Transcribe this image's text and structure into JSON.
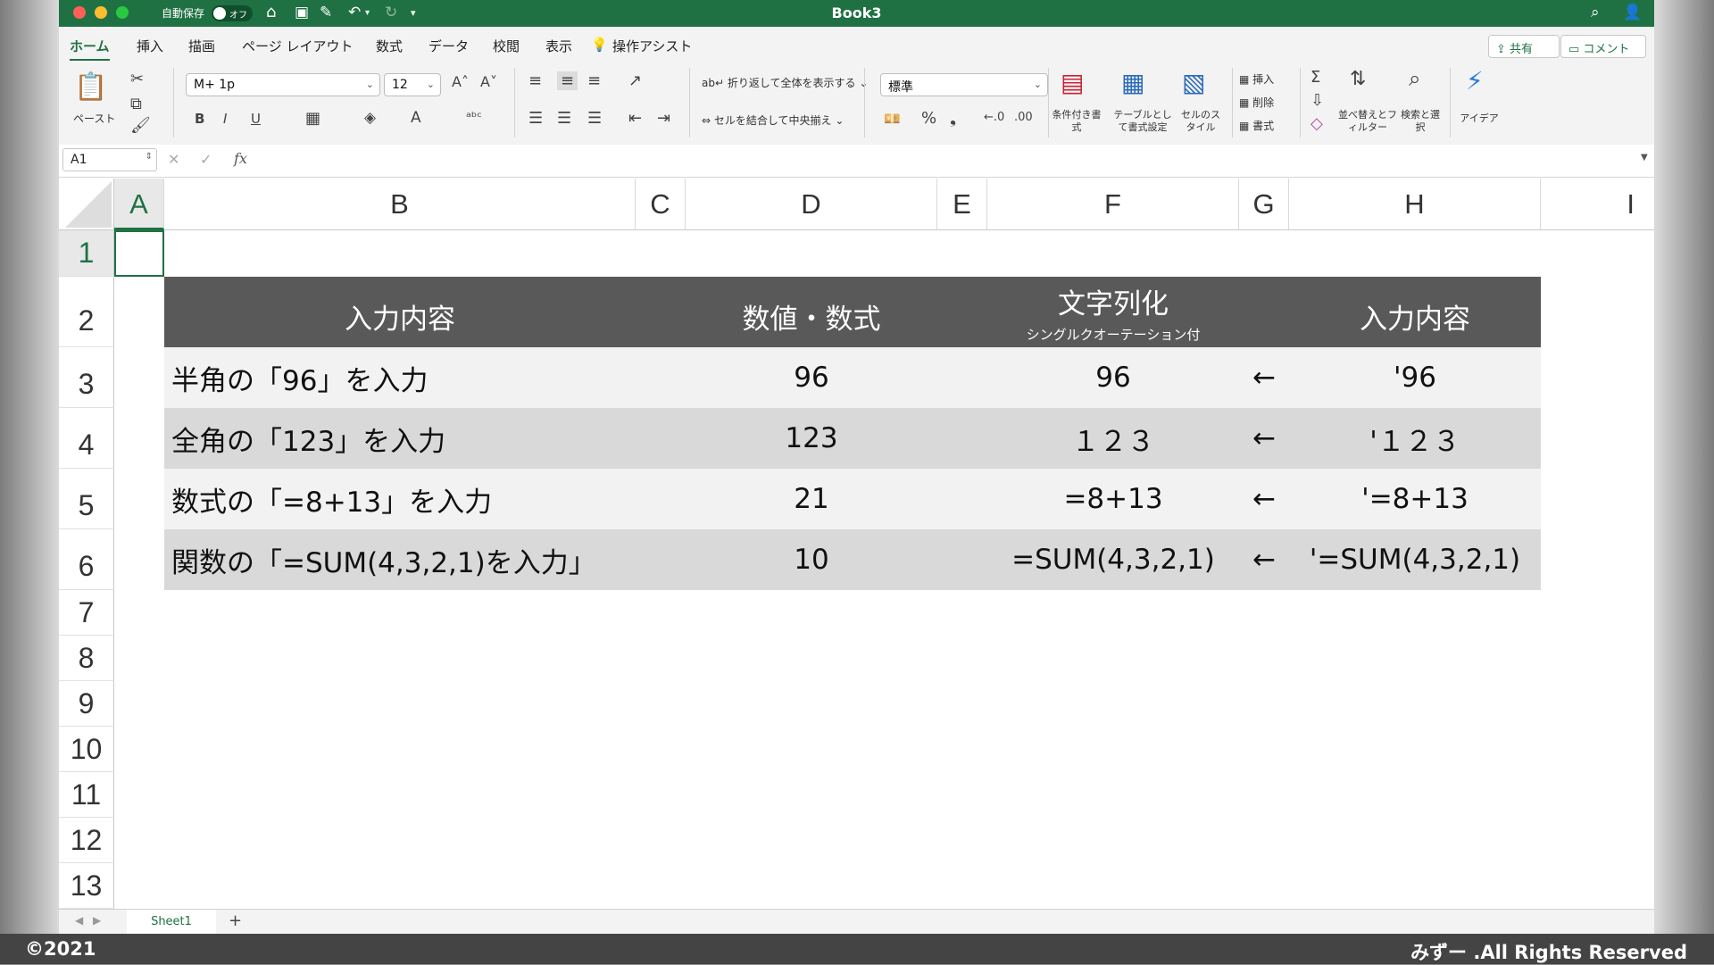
{
  "window": {
    "title": "Book3",
    "autosave_label": "自動保存",
    "autosave_state": "オフ"
  },
  "ribbon": {
    "tabs": [
      "ホーム",
      "挿入",
      "描画",
      "ページ レイアウト",
      "数式",
      "データ",
      "校閲",
      "表示",
      "操作アシスト"
    ],
    "share_label": "共有",
    "comment_label": "コメント",
    "paste_label": "ペースト",
    "font_name": "M+ 1p",
    "font_size": "12",
    "wrap_label": "折り返して全体を表示する",
    "merge_label": "セルを結合して中央揃え",
    "number_format": "標準",
    "cond_format_label": "条件付き書式",
    "table_format_label": "テーブルとして書式設定",
    "cell_style_label": "セルのスタイル",
    "insert_label": "挿入",
    "delete_label": "削除",
    "format_label": "書式",
    "sort_filter_label": "並べ替えとフィルター",
    "find_select_label": "検索と選択",
    "ideas_label": "アイデア"
  },
  "formula_bar": {
    "name_box": "A1",
    "fx": "fx",
    "content": ""
  },
  "grid": {
    "columns": [
      "A",
      "B",
      "C",
      "D",
      "E",
      "F",
      "G",
      "H",
      "I"
    ],
    "rows": [
      "1",
      "2",
      "3",
      "4",
      "5",
      "6",
      "7",
      "8",
      "9",
      "10",
      "11",
      "12",
      "13"
    ],
    "header": {
      "b": "入力内容",
      "d": "数値・数式",
      "f": "文字列化",
      "f_sub": "シングルクオーテーション付",
      "h": "入力内容"
    },
    "data_rows": [
      {
        "b": "半角の「96」を入力",
        "d": "96",
        "f": "96",
        "g": "←",
        "h": "'96"
      },
      {
        "b": "全角の「123」を入力",
        "d": "123",
        "f": "１２３",
        "g": "←",
        "h": "'１２３"
      },
      {
        "b": "数式の「=8+13」を入力",
        "d": "21",
        "f": "=8+13",
        "g": "←",
        "h": "'=8+13"
      },
      {
        "b": "関数の「=SUM(4,3,2,1)を入力」",
        "d": "10",
        "f": "=SUM(4,3,2,1)",
        "g": "←",
        "h": "'=SUM(4,3,2,1)"
      }
    ]
  },
  "sheet_tabs": {
    "active": "Sheet1",
    "add": "+"
  },
  "footer": {
    "left": "©2021",
    "right": "みずー .All Rights Reserved"
  },
  "colors": {
    "excel_green": "#1f7143",
    "header_fill": "#595959",
    "band_light": "#f2f2f2",
    "band_dark": "#d9d9d9"
  }
}
